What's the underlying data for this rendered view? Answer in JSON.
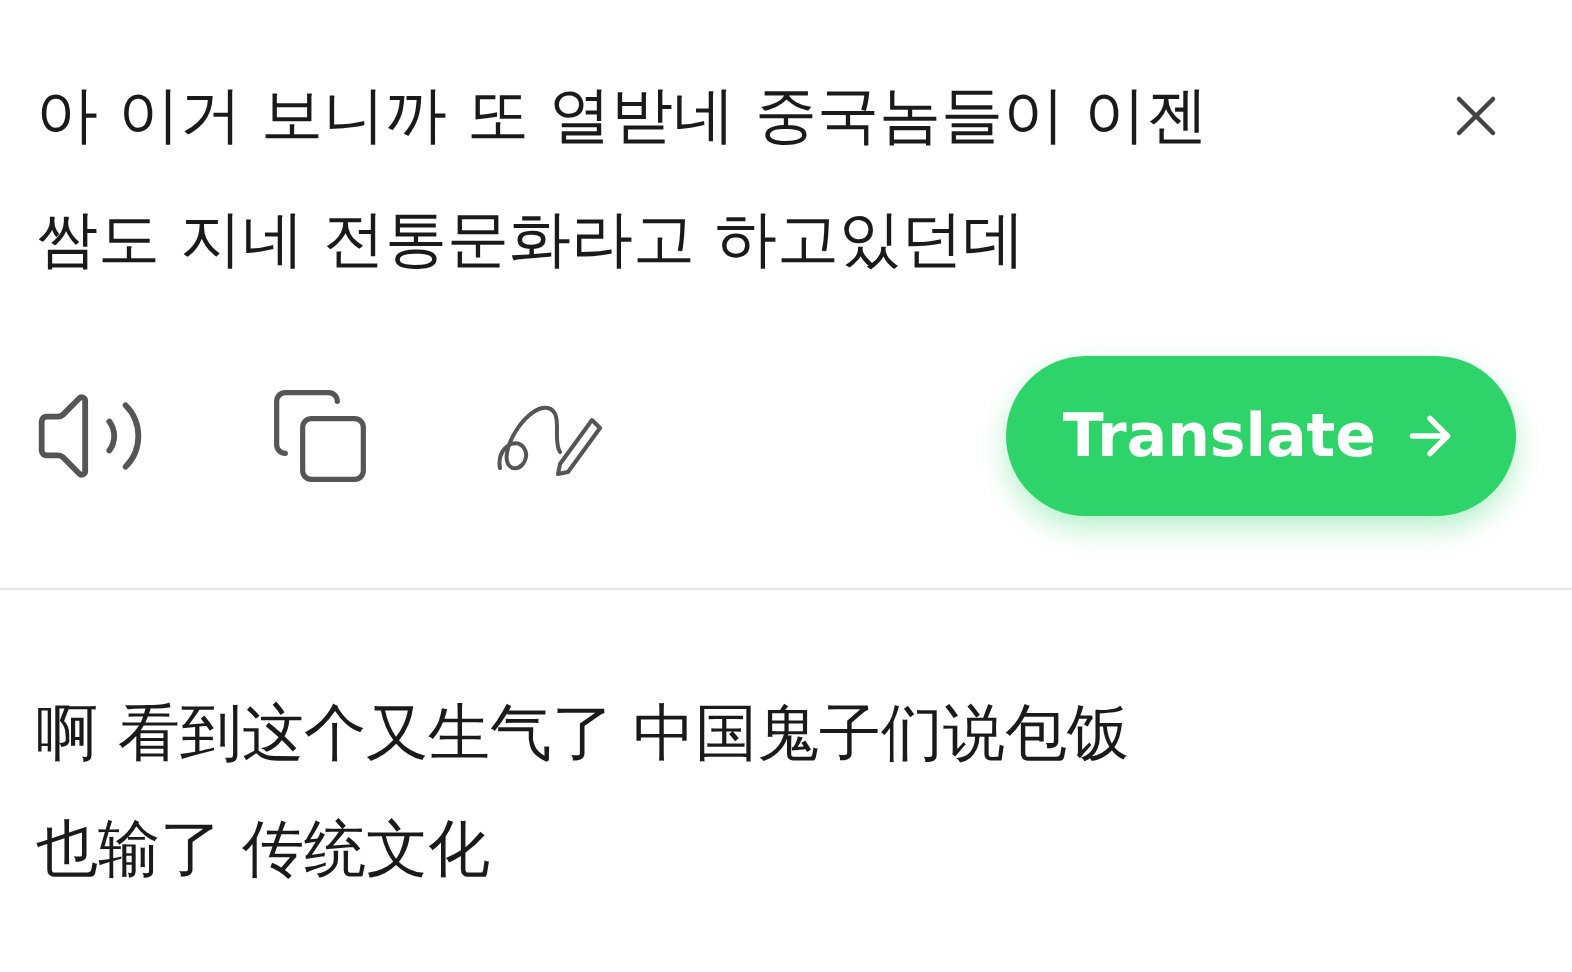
{
  "source": {
    "lines": [
      "아 이거 보니까 또 열받네 중국놈들이 이젠",
      "쌈도 지네 전통문화라고 하고있던데"
    ]
  },
  "translate_button": {
    "label": "Translate"
  },
  "result": {
    "lines": [
      "啊 看到这个又生气了 中国鬼子们说包饭",
      "也输了 传统文化"
    ]
  }
}
